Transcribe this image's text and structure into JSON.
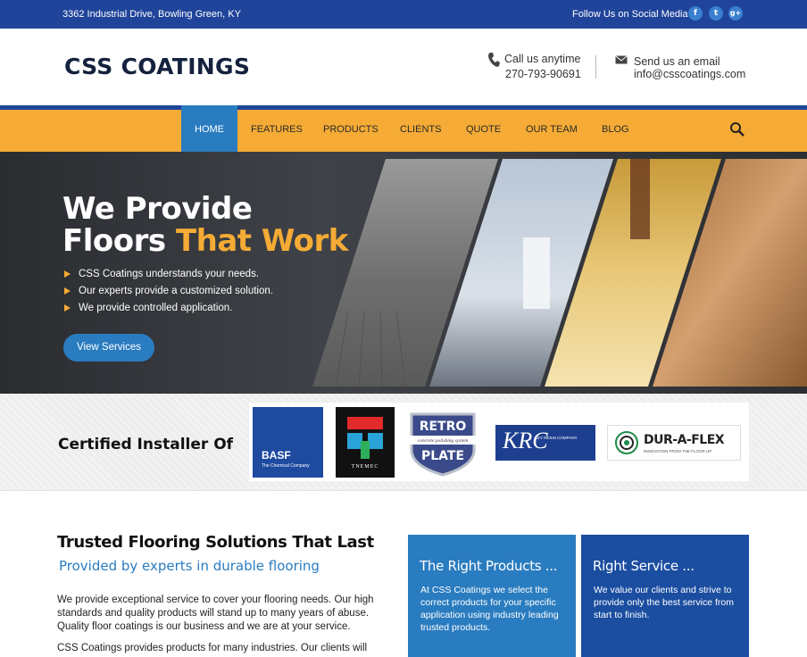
{
  "topbar": {
    "address": "3362 Industrial Drive, Bowling Green, KY",
    "follow": "Follow Us on Social Media",
    "social": [
      {
        "icon": "facebook-icon",
        "glyph": "f"
      },
      {
        "icon": "twitter-icon",
        "glyph": "t"
      },
      {
        "icon": "google-plus-icon",
        "glyph": "g+"
      }
    ]
  },
  "header": {
    "logo": "CSS COATINGS",
    "call_label": "Call us anytime",
    "call_number": "270-793-90691",
    "email_label": "Send us an email",
    "email_address": "info@csscoatings.com"
  },
  "nav": {
    "items": [
      {
        "label": "HOME",
        "active": true
      },
      {
        "label": "FEATURES"
      },
      {
        "label": "PRODUCTS"
      },
      {
        "label": "CLIENTS"
      },
      {
        "label": "QUOTE"
      },
      {
        "label": "OUR TEAM"
      },
      {
        "label": "BLOG"
      }
    ]
  },
  "hero": {
    "line1": "We Provide",
    "line2a": "Floors ",
    "line2b": "That Work",
    "bullets": [
      "CSS Coatings understands your needs.",
      "Our experts provide a customized solution.",
      "We provide controlled application."
    ],
    "button": "View Services"
  },
  "certified": {
    "title": "Certified Installer Of",
    "basf": {
      "name": "BASF",
      "tagline": "The Chemical Company"
    },
    "tnemec": "TNEMEC",
    "retro": {
      "line1": "RETRO",
      "line2": "concrete polishing system",
      "line3": "PLATE"
    },
    "krc": {
      "letters": "KRC",
      "name": "KEY RESIN COMPANY"
    },
    "duraflex": {
      "name": "DUR-A-FLEX",
      "tagline": "INNOVATION FROM THE FLOOR UP"
    }
  },
  "main": {
    "title": "Trusted Flooring Solutions That Last",
    "subtitle": "Provided by experts in durable flooring",
    "para1": "We provide exceptional service to cover your flooring needs. Our high standards and quality products will stand up to many years of abuse. Quality floor coatings is our business and we are at your service.",
    "para2": "CSS Coatings provides products for many industries. Our clients will",
    "boxes": [
      {
        "title": "The Right Products ...",
        "text": "At CSS Coatings we select the correct products for your specific application using industry leading trusted products.",
        "color": "#2a7cc0"
      },
      {
        "title": "Right Service ...",
        "text": "We value our clients and strive to provide only the best service from start to finish.",
        "color": "#1b4ea0"
      }
    ]
  }
}
